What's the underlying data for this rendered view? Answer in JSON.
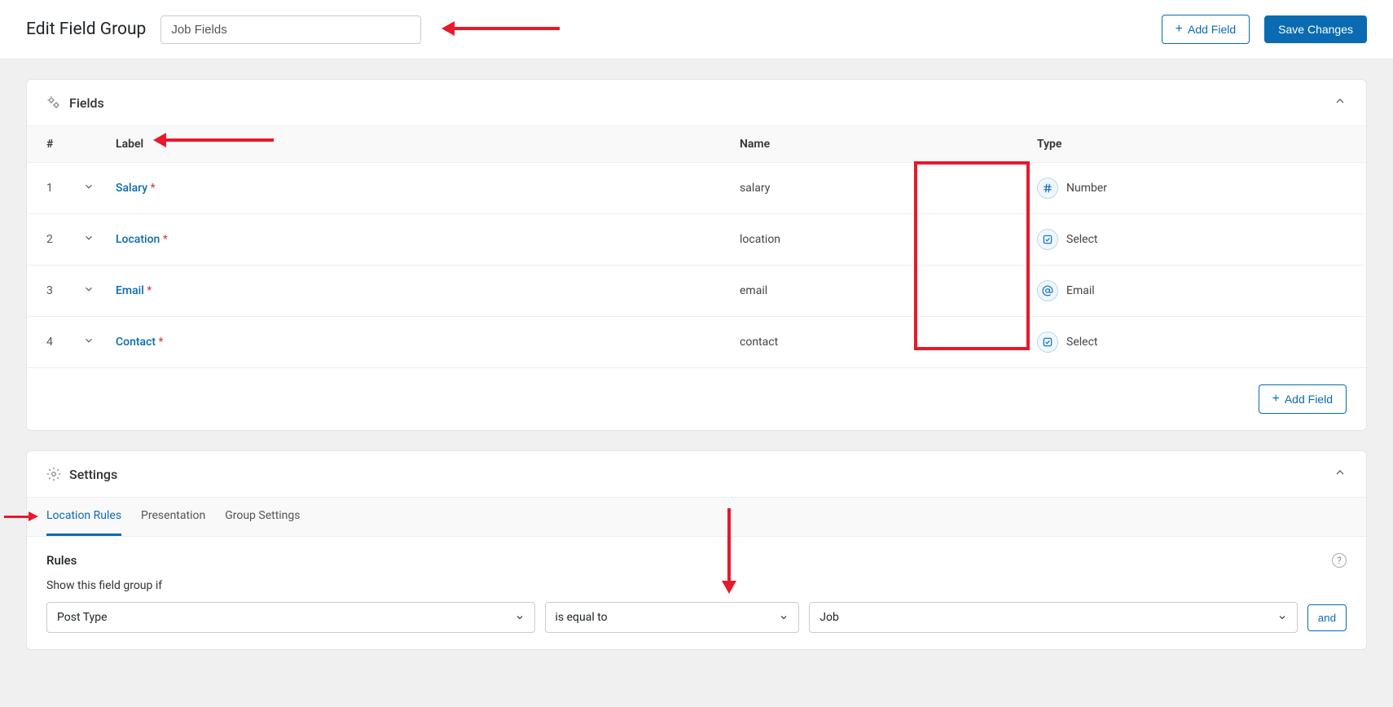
{
  "header": {
    "title": "Edit Field Group",
    "group_name_value": "Job Fields",
    "add_field_label": "Add Field",
    "save_label": "Save Changes"
  },
  "fields_panel": {
    "title": "Fields",
    "columns": {
      "num": "#",
      "label": "Label",
      "name": "Name",
      "type": "Type"
    },
    "rows": [
      {
        "num": "1",
        "label": "Salary",
        "required": true,
        "name": "salary",
        "type": "Number",
        "icon": "hash"
      },
      {
        "num": "2",
        "label": "Location",
        "required": true,
        "name": "location",
        "type": "Select",
        "icon": "check-square"
      },
      {
        "num": "3",
        "label": "Email",
        "required": true,
        "name": "email",
        "type": "Email",
        "icon": "at"
      },
      {
        "num": "4",
        "label": "Contact",
        "required": true,
        "name": "contact",
        "type": "Select",
        "icon": "check-square"
      }
    ],
    "add_field_label": "Add Field"
  },
  "settings_panel": {
    "title": "Settings",
    "tabs": [
      {
        "label": "Location Rules",
        "active": true
      },
      {
        "label": "Presentation",
        "active": false
      },
      {
        "label": "Group Settings",
        "active": false
      }
    ],
    "rules": {
      "heading": "Rules",
      "subheading": "Show this field group if",
      "param": "Post Type",
      "operator": "is equal to",
      "value": "Job",
      "and_label": "and"
    }
  }
}
